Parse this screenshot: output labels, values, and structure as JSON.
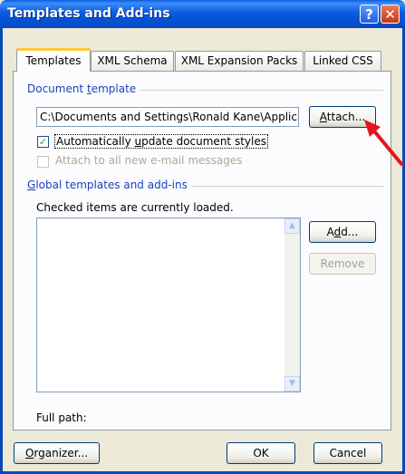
{
  "window": {
    "title": "Templates and Add-ins",
    "help_glyph": "?",
    "close_glyph": "✕"
  },
  "tabs": [
    {
      "label": "Templates",
      "active": true
    },
    {
      "label": "XML Schema",
      "active": false
    },
    {
      "label": "XML Expansion Packs",
      "active": false
    },
    {
      "label": "Linked CSS",
      "active": false
    }
  ],
  "document_template": {
    "group_label_pre": "Document ",
    "group_label_ul": "t",
    "group_label_post": "emplate",
    "path_value": "C:\\Documents and Settings\\Ronald Kane\\Applica",
    "attach_ul": "A",
    "attach_rest": "ttach...",
    "auto_update_pre": "Automatically ",
    "auto_update_ul": "u",
    "auto_update_post": "pdate document styles",
    "auto_update_checked": true,
    "attach_email_label": "Attach to all new e-mail messages",
    "attach_email_checked": false
  },
  "global_templates": {
    "group_label_ul": "G",
    "group_label_rest": "lobal templates and add-ins",
    "info_text": "Checked items are currently loaded.",
    "add_pre": "A",
    "add_ul": "d",
    "add_post": "d...",
    "remove_label": "Remove",
    "full_path_label": "Full path:"
  },
  "footer": {
    "organizer_ul": "O",
    "organizer_rest": "rganizer...",
    "ok_label": "OK",
    "cancel_label": "Cancel"
  },
  "icons": {
    "check": "✓",
    "scroll_up": "▲",
    "scroll_down": "▼"
  },
  "colors": {
    "titlebar": "#0450D2",
    "dialog_bg": "#ECE9D8",
    "group_label": "#1A3FBE",
    "active_tab_accent": "#FFC83C",
    "annotation_arrow": "#E8141B"
  }
}
